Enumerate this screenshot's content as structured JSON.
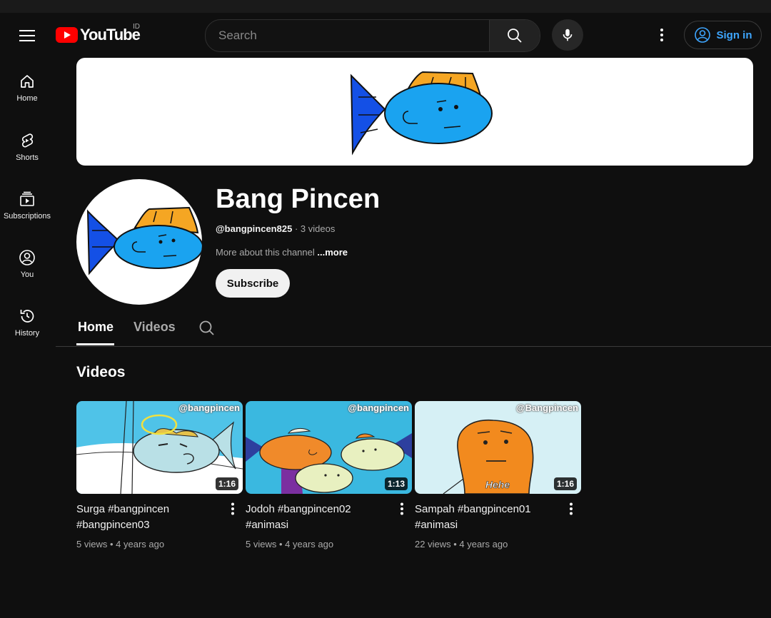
{
  "header": {
    "logo_text": "YouTube",
    "region": "ID",
    "search_placeholder": "Search",
    "signin_label": "Sign in"
  },
  "sidebar": {
    "items": [
      {
        "label": "Home"
      },
      {
        "label": "Shorts"
      },
      {
        "label": "Subscriptions"
      },
      {
        "label": "You"
      },
      {
        "label": "History"
      }
    ]
  },
  "channel": {
    "name": "Bang Pincen",
    "handle": "@bangpincen825",
    "video_count": "3 videos",
    "about": "More about this channel",
    "more": "...more",
    "subscribe_label": "Subscribe"
  },
  "tabs": [
    {
      "label": "Home",
      "active": true
    },
    {
      "label": "Videos",
      "active": false
    }
  ],
  "section": {
    "title": "Videos"
  },
  "videos": [
    {
      "title": "Surga #bangpincen #bangpincen03",
      "views": "5 views",
      "age": "4 years ago",
      "duration": "1:16",
      "watermark": "@bangpincen"
    },
    {
      "title": "Jodoh #bangpincen02 #animasi",
      "views": "5 views",
      "age": "4 years ago",
      "duration": "1:13",
      "watermark": "@bangpincen"
    },
    {
      "title": "Sampah #bangpincen01 #animasi",
      "views": "22 views",
      "age": "4 years ago",
      "duration": "1:16",
      "watermark": "@Bangpincen",
      "caption": "Hehe"
    }
  ],
  "colors": {
    "background": "#0f0f0f",
    "accent": "#3ea6ff",
    "brand": "#ff0000"
  }
}
